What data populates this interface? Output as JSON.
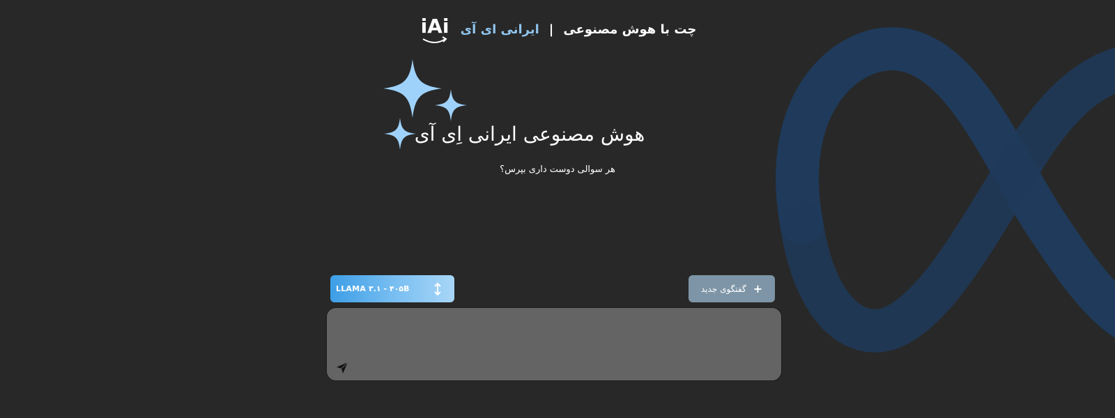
{
  "header": {
    "title": "چت با هوش مصنوعی",
    "separator": "|",
    "brand": "ایرانی ای آی",
    "logo_text": "iAi",
    "logo_icon": "iai-logo"
  },
  "hero": {
    "title": "هوش مصنوعی ایرانی اِی آی",
    "subtitle": "هر سوالی دوست داری بپرس؟",
    "icon": "sparkles-icon"
  },
  "controls": {
    "model_label": "LLAMA ۳.۱ - ۴۰۵B",
    "model_icon": "up-down-arrow-icon",
    "new_chat_label": "گفتگوی جدید",
    "new_chat_icon": "plus-icon"
  },
  "input": {
    "value": "",
    "placeholder": "",
    "send_icon": "send-icon"
  },
  "background": {
    "logo": "meta-infinity-logo",
    "color": "#1f3a5a"
  },
  "colors": {
    "page_bg": "#282828",
    "accent": "#8fc5ef",
    "sparkle": "#9fd2fb",
    "input_bg": "#646464",
    "new_chat_bg": "#7d95a6"
  }
}
